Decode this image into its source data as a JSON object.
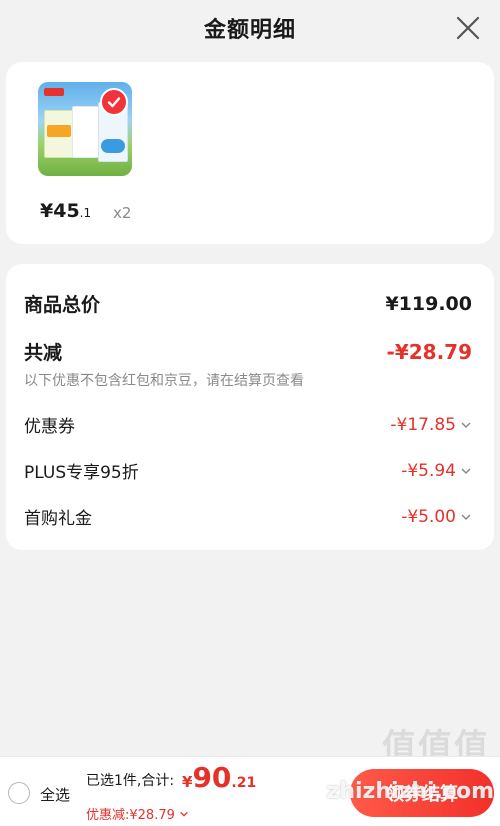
{
  "header": {
    "title": "金额明细"
  },
  "product": {
    "price_main": "¥45",
    "price_cents": ".1",
    "quantity": "x2",
    "thumbnail": "milk-product-thumbnail",
    "selected": true
  },
  "summary": {
    "total_label": "商品总价",
    "total_value": "¥119.00",
    "reduce_label": "共减",
    "reduce_value": "-¥28.79",
    "reduce_note": "以下优惠不包含红包和京豆，请在结算页查看",
    "items": [
      {
        "label": "优惠券",
        "value": "-¥17.85"
      },
      {
        "label": "PLUS专享95折",
        "value": "-¥5.94"
      },
      {
        "label": "首购礼金",
        "value": "-¥5.00"
      }
    ]
  },
  "footer": {
    "select_all": "全选",
    "selected_info": "已选1件,合计:",
    "total_yen": "¥",
    "total_big": "90",
    "total_small": ".21",
    "discount_text": "优惠减:¥28.79",
    "checkout_label": "领券结算",
    "watermark": "zhizhizhi.com",
    "watermark_big": "值值值"
  },
  "colors": {
    "accent": "#e8302a",
    "background": "#f2f2f2",
    "card": "#ffffff"
  }
}
